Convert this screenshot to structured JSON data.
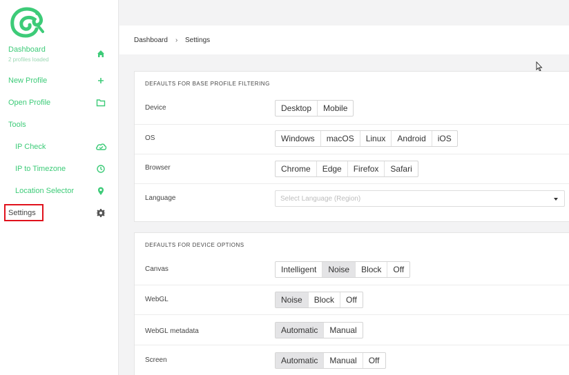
{
  "sidebar": {
    "dashboard": {
      "label": "Dashboard",
      "sub": "2 profiles loaded"
    },
    "new_profile": "New Profile",
    "open_profile": "Open Profile",
    "tools": "Tools",
    "ip_check": "IP Check",
    "ip_timezone": "IP to Timezone",
    "location_selector": "Location Selector",
    "settings": "Settings"
  },
  "breadcrumb": {
    "root": "Dashboard",
    "separator": "›",
    "current": "Settings"
  },
  "base_filtering": {
    "title": "DEFAULTS FOR BASE PROFILE FILTERING",
    "device": {
      "label": "Device",
      "options": [
        "Desktop",
        "Mobile"
      ]
    },
    "os": {
      "label": "OS",
      "options": [
        "Windows",
        "macOS",
        "Linux",
        "Android",
        "iOS"
      ]
    },
    "browser": {
      "label": "Browser",
      "options": [
        "Chrome",
        "Edge",
        "Firefox",
        "Safari"
      ]
    },
    "language": {
      "label": "Language",
      "placeholder": "Select Language (Region)"
    }
  },
  "device_options": {
    "title": "DEFAULTS FOR DEVICE OPTIONS",
    "canvas": {
      "label": "Canvas",
      "options": [
        "Intelligent",
        "Noise",
        "Block",
        "Off"
      ],
      "selected": "Noise"
    },
    "webgl": {
      "label": "WebGL",
      "options": [
        "Noise",
        "Block",
        "Off"
      ],
      "selected": "Noise"
    },
    "webgl_metadata": {
      "label": "WebGL metadata",
      "options": [
        "Automatic",
        "Manual"
      ],
      "selected": "Automatic"
    },
    "screen": {
      "label": "Screen",
      "options": [
        "Automatic",
        "Manual",
        "Off"
      ],
      "selected": "Automatic"
    }
  },
  "colors": {
    "accent": "#3dcb78",
    "highlight": "#e0101b"
  }
}
